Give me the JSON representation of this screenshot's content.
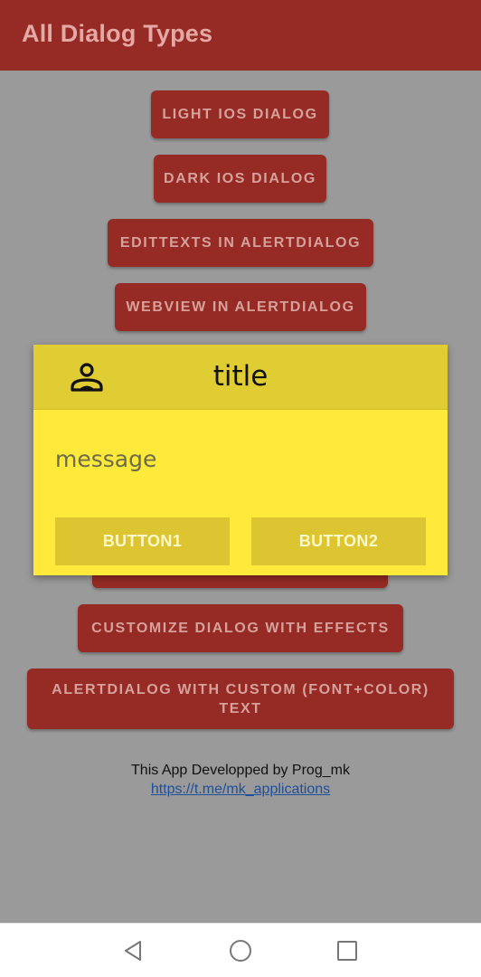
{
  "appbar": {
    "title": "All Dialog Types"
  },
  "buttons": {
    "light_ios": "LIGHT IOS DIALOG",
    "dark_ios": "DARK IOS DIALOG",
    "edittexts": "EDITTEXTS IN ALERTDIALOG",
    "webview": "WEBVIEW IN ALERTDIALOG",
    "effects": "CUSTOMIZE DIALOG WITH EFFECTS",
    "custom_text": "ALERTDIALOG WITH CUSTOM (FONT+COLOR) TEXT"
  },
  "footer": {
    "credit": "This App Developped by Prog_mk",
    "link": "https://t.me/mk_applications"
  },
  "dialog": {
    "icon": "person-icon",
    "title": "title",
    "message": "message",
    "button1": "BUTTON1",
    "button2": "BUTTON2"
  },
  "navbar": {
    "back_icon": "back-triangle-icon",
    "home_icon": "home-circle-icon",
    "recents_icon": "recents-square-icon"
  },
  "colors": {
    "primary": "#962a25",
    "dialog_body": "#ffe93a",
    "dialog_header": "#e0cc33",
    "dialog_button": "#dcc530",
    "scrim": "#9a9a9a"
  }
}
